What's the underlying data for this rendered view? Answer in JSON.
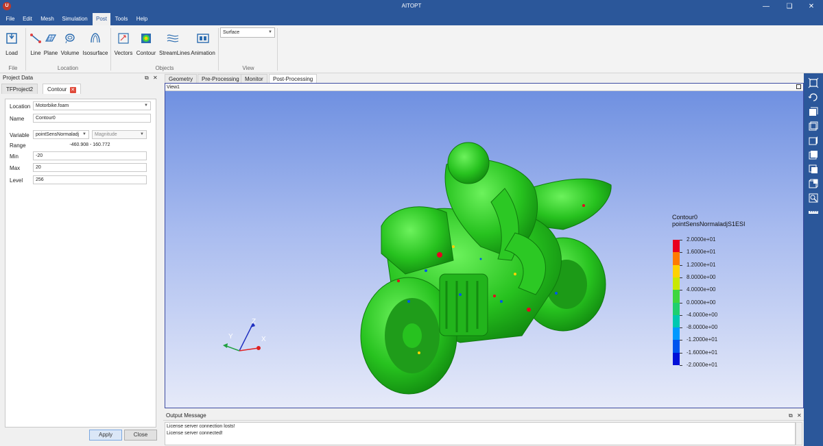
{
  "app": {
    "title": "AITOPT",
    "icon_letter": "U"
  },
  "menu": {
    "items": [
      "File",
      "Edit",
      "Mesh",
      "Simulation",
      "Post",
      "Tools",
      "Help"
    ],
    "active": "Post"
  },
  "ribbon": {
    "buttons": [
      "Load",
      "Line",
      "Plane",
      "Volume",
      "Isosurface",
      "Vectors",
      "Contour",
      "StreamLines",
      "Animation"
    ],
    "groups": [
      "File",
      "Location",
      "Objects",
      "View"
    ],
    "view_select": "Surface"
  },
  "project_panel": {
    "title": "Project Data",
    "tabs": [
      "TFProject2",
      "Contour"
    ],
    "fields": {
      "location_label": "Location",
      "location_value": "Motorbike.foam",
      "name_label": "Name",
      "name_value": "Contour0",
      "variable_label": "Variable",
      "variable_value": "pointSensNormaladj",
      "variable_mode": "Magnitude",
      "range_label": "Range",
      "range_value": "-460.908 - 160.772",
      "min_label": "Min",
      "min_value": "-20",
      "max_label": "Max",
      "max_value": "20",
      "level_label": "Level",
      "level_value": "256"
    },
    "apply_label": "Apply",
    "close_label": "Close"
  },
  "doc_tabs": [
    "Geometry",
    "Pre-Processing",
    "Monitor",
    "Post-Processing"
  ],
  "view": {
    "title": "View1",
    "legend_title": "Contour0",
    "legend_subtitle": "pointSensNormaladjS1ESI",
    "legend_ticks": [
      "2.0000e+01",
      "1.6000e+01",
      "1.2000e+01",
      "8.0000e+00",
      "4.0000e+00",
      "0.0000e+00",
      "-4.0000e+00",
      "-8.0000e+00",
      "-1.2000e+01",
      "-1.6000e+01",
      "-2.0000e+01"
    ],
    "legend_colors": [
      "#e8001f",
      "#ff7b00",
      "#ffd200",
      "#c9e800",
      "#3fd63f",
      "#1fcf6f",
      "#00c8b0",
      "#0099ff",
      "#0055ee",
      "#0010d8"
    ],
    "axes": {
      "x": "X",
      "y": "Y",
      "z": "Z",
      "x_color": "#e02020",
      "y_color": "#20a040",
      "z_color": "#2030c0"
    }
  },
  "output": {
    "title": "Output Message",
    "lines": [
      "License server connection losts!",
      "License server connected!"
    ]
  }
}
